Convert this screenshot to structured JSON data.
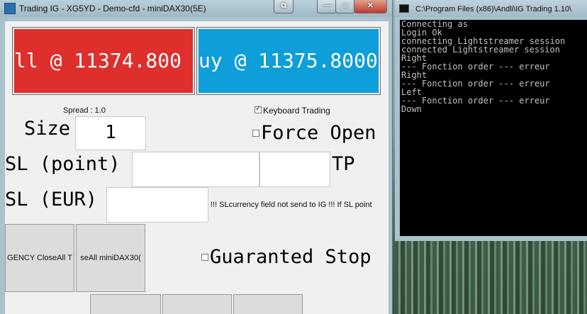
{
  "main_window": {
    "title": "Trading IG - XG5YD - Demo-cfd - miniDAX30(5E)",
    "controls": {
      "restore_glyph": "⧉",
      "minimize_glyph": "—",
      "maximize_glyph": "□",
      "close_glyph": "✕"
    },
    "sell_button": "ll @ 11374.800",
    "buy_button": "uy @ 11375.8000",
    "spread_label": "Spread : 1.0",
    "keyboard_trading": {
      "label": "Keyboard Trading",
      "checked": true
    },
    "size_label": "Size",
    "size_value": "1",
    "force_open": {
      "label": "Force Open",
      "checked": false
    },
    "sl_point_label": "SL (point)",
    "sl_point_value": "",
    "tp_value": "",
    "tp_label": "TP",
    "sl_eur_label": "SL (EUR)",
    "sl_eur_value": "",
    "sl_warning": "!!! SLcurrency field not send to IG !!! If SL point",
    "emergency_button": "GENCY CloseAll T",
    "close_all_button": "seAll miniDAX30(",
    "guaranteed_stop": {
      "label": "Guaranted Stop",
      "checked": false
    },
    "bottom_buttons": [
      "",
      "",
      ""
    ]
  },
  "console_window": {
    "title": "C:\\Program Files (x86)\\Andli\\IG Trading 1.10\\",
    "lines": [
      "Connecting as",
      "Login Ok",
      "connecting Lightstreamer session",
      "connected Lightstreamer session",
      "Right",
      "--- Fonction order --- erreur",
      "Right",
      "--- Fonction order --- erreur",
      "Left",
      "--- Fonction order --- erreur",
      "Down"
    ]
  },
  "colors": {
    "sell": "#de2f2c",
    "buy": "#0e9ed9"
  }
}
